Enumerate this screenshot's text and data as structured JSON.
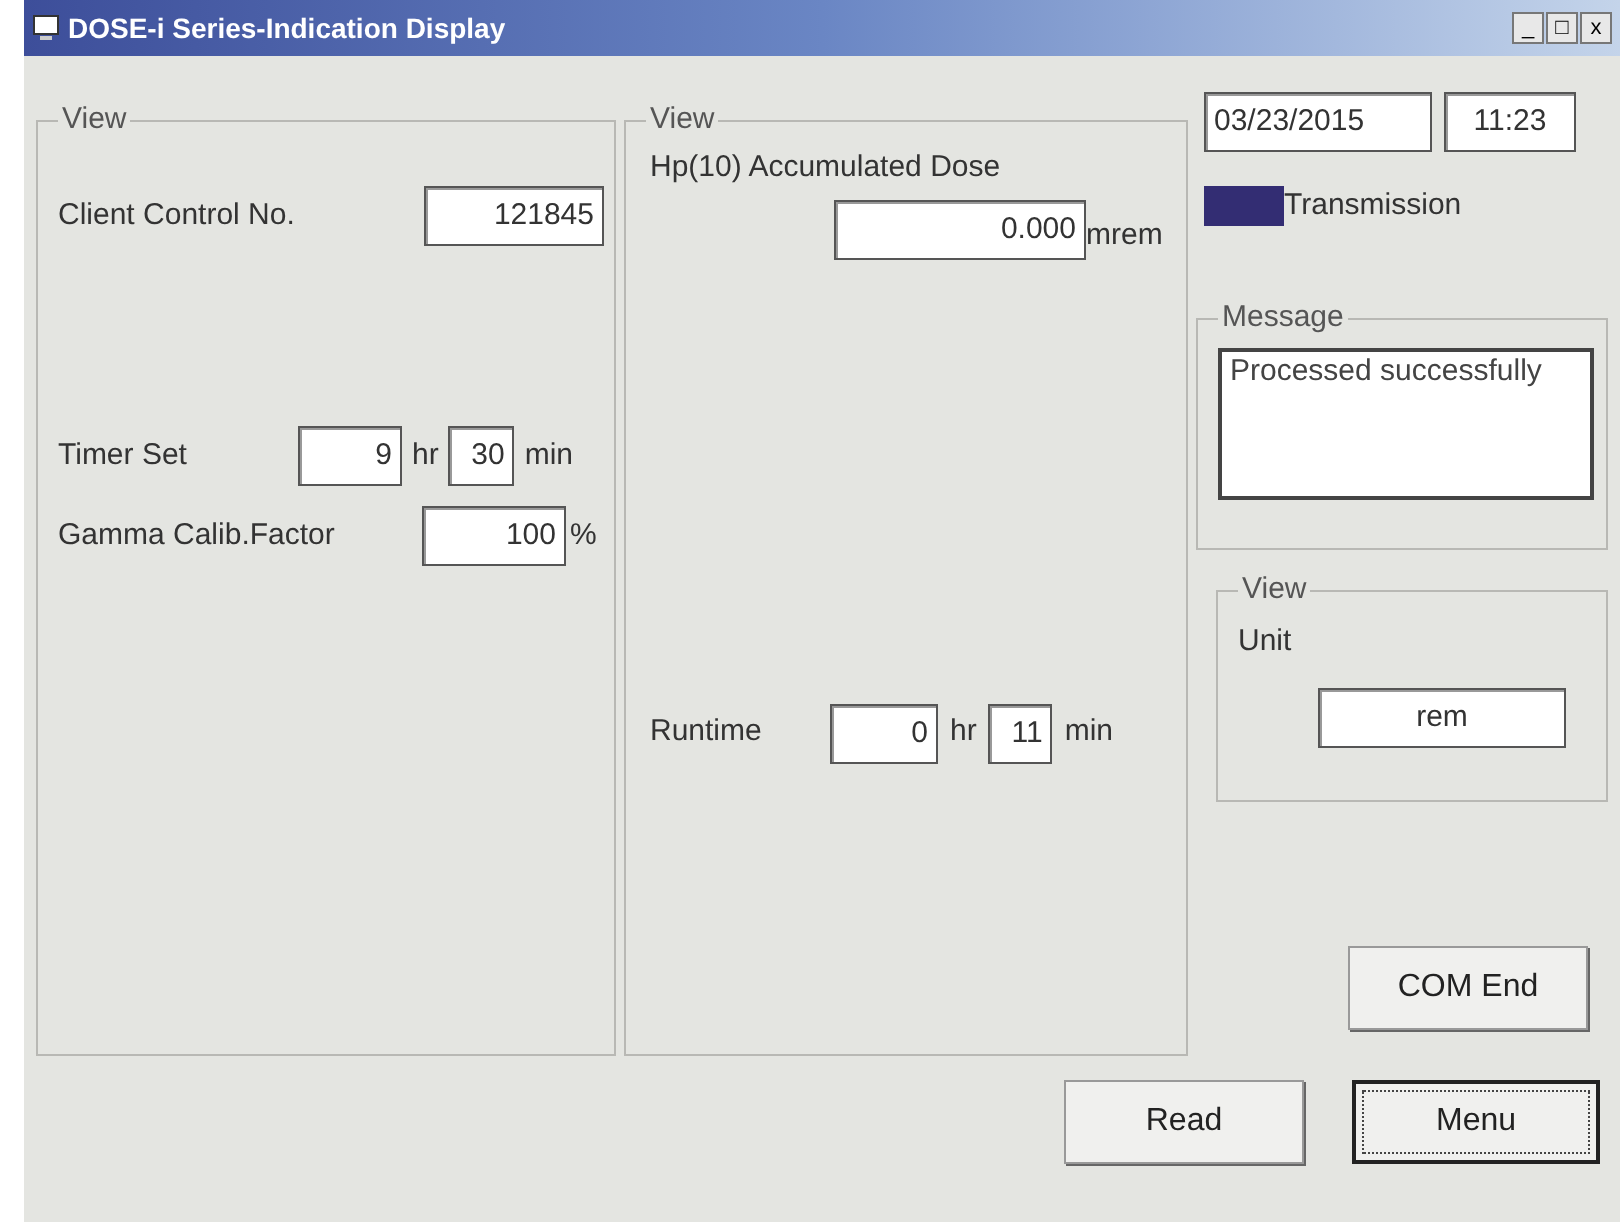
{
  "window": {
    "title": "DOSE-i Series-Indication Display",
    "controls": [
      "_",
      "□",
      "x"
    ]
  },
  "left_group": {
    "legend": "View",
    "client_control": {
      "label": "Client Control No.",
      "value": "121845"
    },
    "timer_set": {
      "label": "Timer Set",
      "hours": "9",
      "hr_unit": "hr",
      "minutes": "30",
      "min_unit": "min"
    },
    "gamma": {
      "label": "Gamma Calib.Factor",
      "value": "100",
      "unit": "%"
    }
  },
  "middle_group": {
    "legend": "View",
    "dose": {
      "label": "Hp(10) Accumulated Dose",
      "value": "0.000",
      "unit": "mrem"
    },
    "runtime": {
      "label": "Runtime",
      "hours": "0",
      "hr_unit": "hr",
      "minutes": "11",
      "min_unit": "min"
    }
  },
  "date": "03/23/2015",
  "time": "11:23",
  "transmission": {
    "label": "Transmission",
    "on": true
  },
  "message": {
    "legend": "Message",
    "text": "Processed successfully"
  },
  "unit_group": {
    "legend": "View",
    "label": "Unit",
    "value": "rem"
  },
  "buttons": [
    {
      "label": "COM End",
      "focused": false
    },
    {
      "label": "Read",
      "focused": false
    },
    {
      "label": "Menu",
      "focused": true
    }
  ]
}
